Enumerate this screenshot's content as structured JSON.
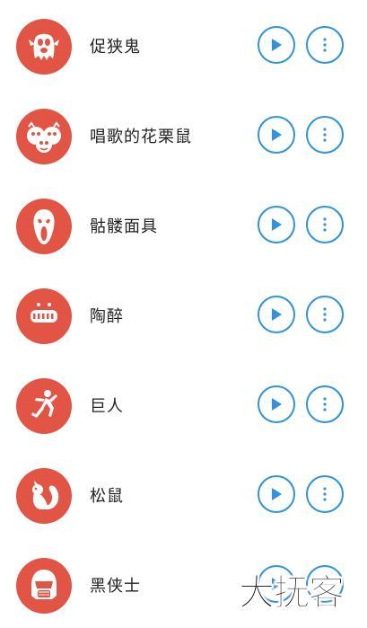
{
  "colors": {
    "avatar_bg": "#e25544",
    "accent": "#2f93df",
    "text": "#222222"
  },
  "items": [
    {
      "label": "促狭鬼",
      "icon": "ghost-icon"
    },
    {
      "label": "唱歌的花栗鼠",
      "icon": "chipmunks-icon"
    },
    {
      "label": "骷髅面具",
      "icon": "scream-mask-icon"
    },
    {
      "label": "陶醉",
      "icon": "grin-face-icon"
    },
    {
      "label": "巨人",
      "icon": "giant-dancing-icon"
    },
    {
      "label": "松鼠",
      "icon": "squirrel-icon"
    },
    {
      "label": "黑侠士",
      "icon": "dark-knight-icon"
    }
  ],
  "watermark": {
    "text": "大抚客"
  }
}
